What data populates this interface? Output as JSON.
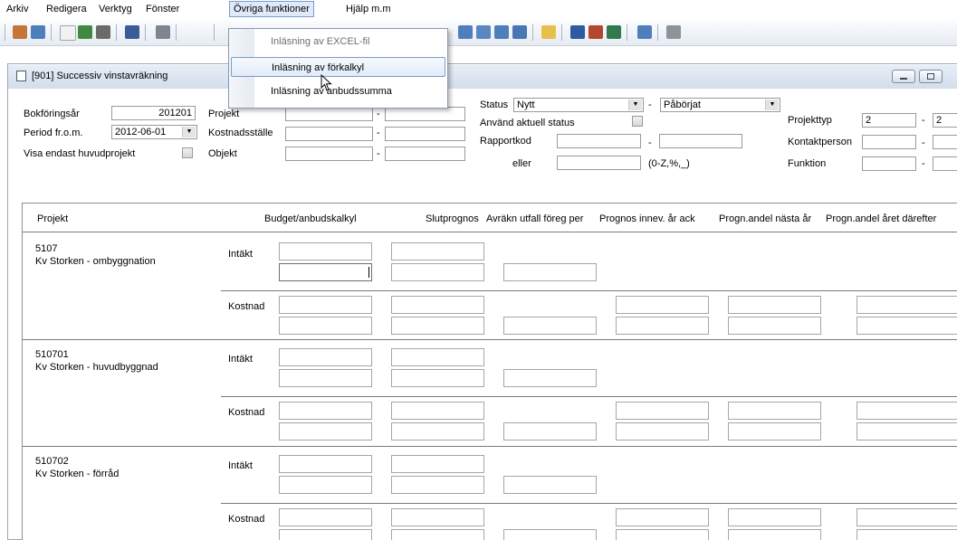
{
  "menubar": {
    "items": [
      {
        "label": "Arkiv"
      },
      {
        "label": "Redigera"
      },
      {
        "label": "Verktyg"
      },
      {
        "label": "Fönster"
      },
      {
        "label": "Övriga funktioner"
      },
      {
        "label": "Hjälp m.m"
      }
    ]
  },
  "dropdown": {
    "items": [
      {
        "label": "Inläsning av EXCEL-fil"
      },
      {
        "label": "Inläsning av förkalkyl"
      },
      {
        "label": "Inläsning av anbudssumma"
      }
    ]
  },
  "window": {
    "title": "[901]  Successiv vinstavräkning"
  },
  "filters": {
    "bokforingsar_label": "Bokföringsår",
    "bokforingsar_value": "201201",
    "period_label": "Period fr.o.m.",
    "period_value": "2012-06-01",
    "visa_label": "Visa endast huvudprojekt",
    "projekt_label": "Projekt",
    "kostnadsstalle_label": "Kostnadsställe",
    "objekt_label": "Objekt",
    "status_label": "Status",
    "status_value": "Nytt",
    "status_value2": "Påbörjat",
    "anvand_label": "Använd aktuell status",
    "rapportkod_label": "Rapportkod",
    "eller_label": "eller",
    "hint": "(0-Z,%,_)",
    "projekttyp_label": "Projekttyp",
    "projekttyp_from": "2",
    "projekttyp_to": "2",
    "kontaktperson_label": "Kontaktperson",
    "funktion_label": "Funktion",
    "dash": "-"
  },
  "grid": {
    "headers": {
      "projekt": "Projekt",
      "budget": "Budget/anbudskalkyl",
      "slutprognos": "Slutprognos",
      "avrakn": "Avräkn utfall föreg per",
      "prognos": "Prognos innev. år ack",
      "andel_nasta": "Progn.andel nästa år",
      "andel_darefter": "Progn.andel året därefter"
    },
    "intakt_label": "Intäkt",
    "kostnad_label": "Kostnad",
    "projects": [
      {
        "code": "5107",
        "name": "Kv Storken - ombyggnation"
      },
      {
        "code": "510701",
        "name": "Kv Storken - huvudbyggnad"
      },
      {
        "code": "510702",
        "name": "Kv Storken - förråd"
      }
    ]
  },
  "colors": {
    "accent": "#7c9cc8",
    "toolbar_bg": "#e6ebf2"
  }
}
